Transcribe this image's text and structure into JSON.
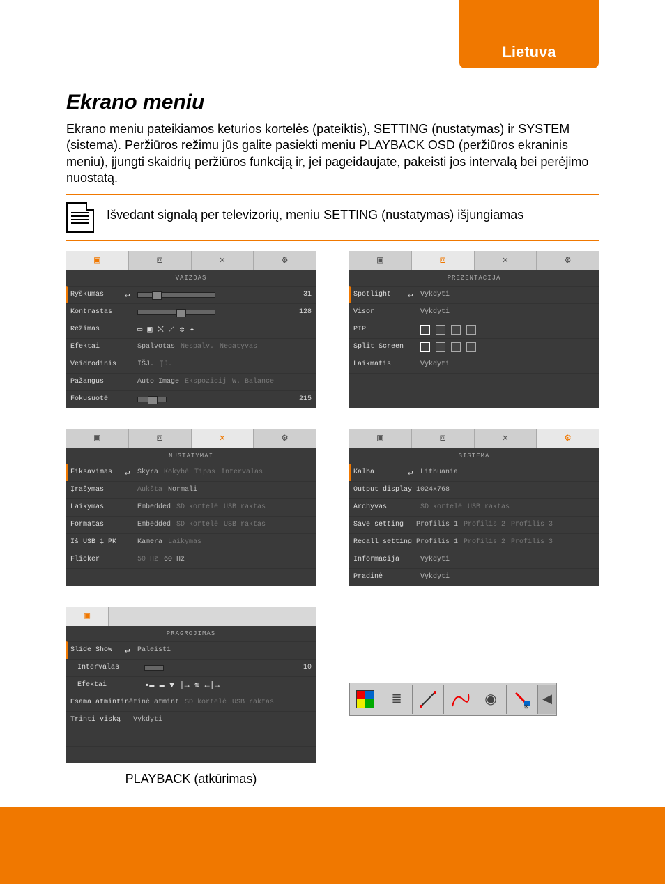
{
  "langTab": "Lietuva",
  "title": "Ekrano meniu",
  "paragraph": "Ekrano meniu pateikiamos keturios kortelės (pateiktis), SETTING (nustatymas) ir SYSTEM (sistema). Peržiūros režimu jūs galite pasiekti meniu PLAYBACK OSD (peržiūros ekraninis meniu), įjungti skaidrių peržiūros funkciją ir, jei pageidaujate, pakeisti jos intervalą bei perėjimo nuostatą.",
  "note": "Išvedant  signalą per televizorių, meniu SETTING (nustatymas) išjungiamas",
  "panel1": {
    "tabTitle": "VAIZDAS",
    "rows": [
      {
        "label": "Ryškumas",
        "enter": "↵",
        "type": "slider",
        "num": "31"
      },
      {
        "label": "Kontrastas",
        "type": "slider",
        "num": "128"
      },
      {
        "label": "Režimas",
        "type": "modeicons"
      },
      {
        "label": "Efektai",
        "values": [
          "Spalvotas",
          "Nespalv.",
          "Negatyvas"
        ]
      },
      {
        "label": "Veidrodinis",
        "values": [
          "IŠJ.",
          "ĮJ."
        ]
      },
      {
        "label": "Pažangus",
        "values": [
          "Auto Image",
          "Ekspozicij",
          "W. Balance"
        ]
      },
      {
        "label": "Fokusuotė",
        "type": "slider",
        "num": "215"
      }
    ]
  },
  "panel2": {
    "tabTitle": "PREZENTACIJA",
    "rows": [
      {
        "label": "Spotlight",
        "enter": "↵",
        "values": [
          "Vykdyti"
        ]
      },
      {
        "label": "Visor",
        "values": [
          "Vykdyti"
        ]
      },
      {
        "label": "PIP",
        "type": "pipicons"
      },
      {
        "label": "Split Screen",
        "type": "spliticons"
      },
      {
        "label": "Laikmatis",
        "values": [
          "Vykdyti"
        ]
      }
    ]
  },
  "panel3": {
    "tabTitle": "NUSTATYMAI",
    "rows": [
      {
        "label": "Fiksavimas",
        "enter": "↵",
        "values": [
          "Skyra",
          "Kokybė",
          "Tipas",
          "Intervalas"
        ]
      },
      {
        "label": "Įrašymas",
        "values": [
          "Aukšta",
          "Normali"
        ]
      },
      {
        "label": "Laikymas",
        "values": [
          "Embedded",
          "SD kortelė",
          "USB raktas"
        ]
      },
      {
        "label": "Formatas",
        "values": [
          "Embedded",
          "SD kortelė",
          "USB raktas"
        ]
      },
      {
        "label": "Iš USB į PK",
        "values": [
          "Kamera",
          "Laikymas"
        ]
      },
      {
        "label": "Flicker",
        "values": [
          "50 Hz",
          "60 Hz"
        ]
      }
    ]
  },
  "panel4": {
    "tabTitle": "SISTEMA",
    "rows": [
      {
        "label": "Kalba",
        "enter": "↵",
        "values": [
          "Lithuania"
        ]
      },
      {
        "label": "Output display",
        "values": [
          "1024x768"
        ]
      },
      {
        "label": "Archyvas",
        "values": [
          "SD kortelė",
          "USB raktas"
        ],
        "alldim": true
      },
      {
        "label": "Save setting",
        "values": [
          "Profilis 1",
          "Profilis 2",
          "Profilis 3"
        ]
      },
      {
        "label": "Recall setting",
        "values": [
          "Profilis 1",
          "Profilis 2",
          "Profilis 3"
        ]
      },
      {
        "label": "Informacija",
        "values": [
          "Vykdyti"
        ]
      },
      {
        "label": "Pradinė",
        "values": [
          "Vykdyti"
        ]
      }
    ]
  },
  "panel5": {
    "tabTitle": "PRAGROJIMAS",
    "rows": [
      {
        "label": "Slide Show",
        "enter": "↵",
        "values": [
          "Paleisti"
        ]
      },
      {
        "label": "Intervalas",
        "type": "shortslider",
        "num": "10",
        "indent": true
      },
      {
        "label": "Efektai",
        "type": "efekticons",
        "indent": true
      },
      {
        "label": "Esama atmintinė",
        "values": [
          "tinė atmint",
          "SD kortelė",
          "USB raktas"
        ]
      },
      {
        "label": "Trinti viską",
        "values": [
          "Vykdyti"
        ]
      }
    ]
  },
  "caption5": "PLAYBACK (atkūrimas)",
  "toolbar": [
    "color-grid-icon",
    "list-icon",
    "line-icon",
    "curve-icon",
    "camera-icon",
    "eraser-icon",
    "collapse-icon"
  ]
}
